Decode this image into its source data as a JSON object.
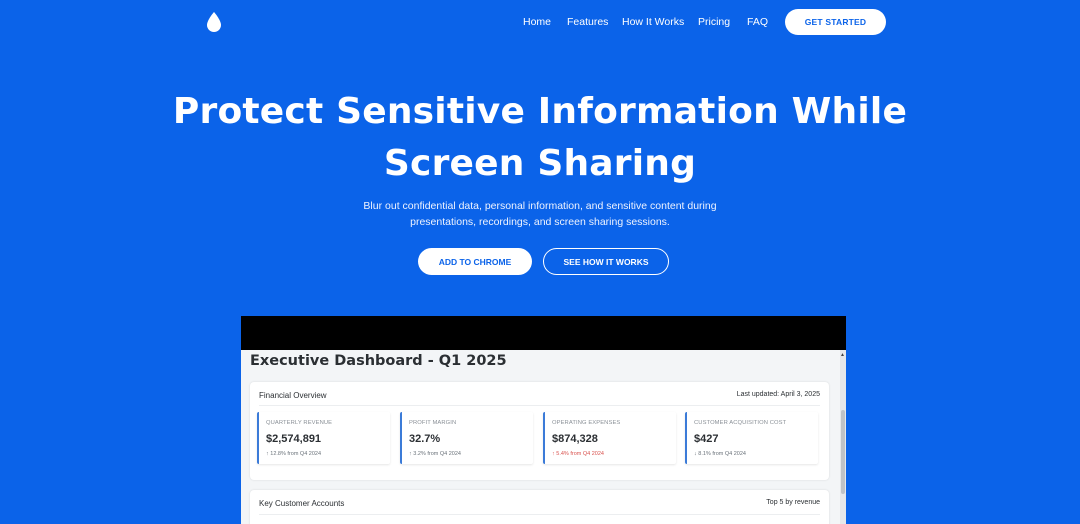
{
  "nav": {
    "logo_icon": "water-drop-icon",
    "links": [
      "Home",
      "Features",
      "How It Works",
      "Pricing",
      "FAQ"
    ],
    "cta": "GET STARTED"
  },
  "hero": {
    "title_line1": "Protect Sensitive Information While",
    "title_line2": "Screen Sharing",
    "subtitle_line1": "Blur out confidential data, personal information, and sensitive content during",
    "subtitle_line2": "presentations, recordings, and screen sharing sessions.",
    "primary_button": "ADD TO CHROME",
    "secondary_button": "SEE HOW IT WORKS"
  },
  "preview": {
    "dashboard_title": "Executive Dashboard - Q1 2025",
    "financial": {
      "heading": "Financial Overview",
      "last_updated": "Last updated: April 3, 2025",
      "metrics": [
        {
          "label": "QUARTERLY REVENUE",
          "value": "$2,574,891",
          "change": "↑ 12.8% from Q4 2024"
        },
        {
          "label": "PROFIT MARGIN",
          "value": "32.7%",
          "change": "↑ 3.2% from Q4 2024"
        },
        {
          "label": "OPERATING EXPENSES",
          "value": "$874,328",
          "change": "↑ 5.4% from Q4 2024"
        },
        {
          "label": "CUSTOMER ACQUISITION COST",
          "value": "$427",
          "change": "↓ 8.1% from Q4 2024"
        }
      ]
    },
    "accounts": {
      "heading": "Key Customer Accounts",
      "meta": "Top 5 by revenue"
    }
  },
  "colors": {
    "brand_blue": "#0b63e9",
    "metric_accent": "#3b7bd8",
    "negative": "#d9534f"
  }
}
